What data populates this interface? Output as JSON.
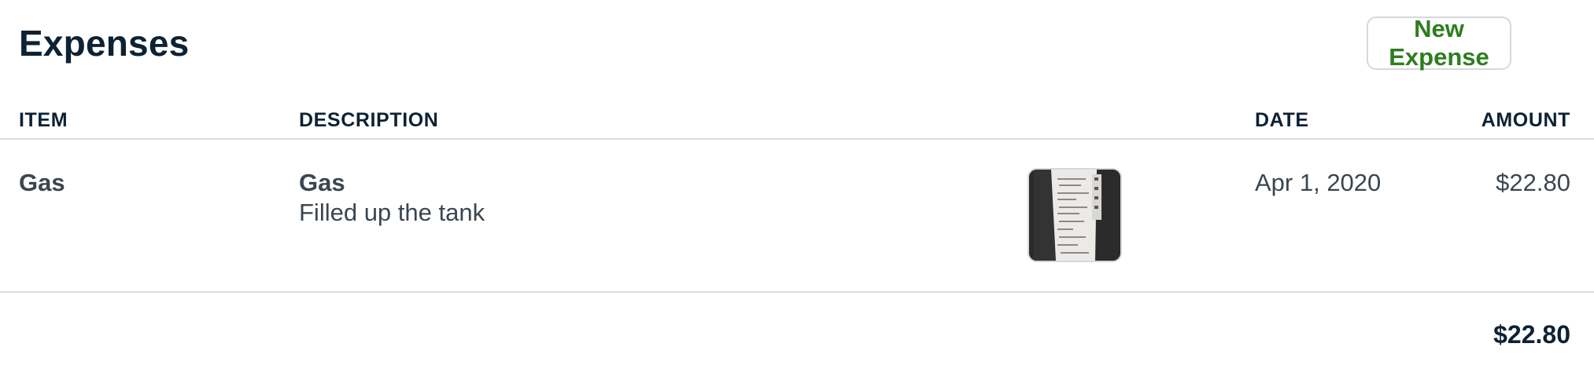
{
  "header": {
    "title": "Expenses",
    "new_button_label": "New Expense",
    "accent_color": "#2e7d1f"
  },
  "table": {
    "columns": {
      "item": "ITEM",
      "description": "DESCRIPTION",
      "date": "DATE",
      "amount": "AMOUNT"
    },
    "rows": [
      {
        "item": "Gas",
        "description_title": "Gas",
        "description_text": "Filled up the tank",
        "attachment_icon": "receipt-thumbnail",
        "date": "Apr 1, 2020",
        "amount": "$22.80"
      }
    ]
  },
  "footer": {
    "total": "$22.80"
  }
}
